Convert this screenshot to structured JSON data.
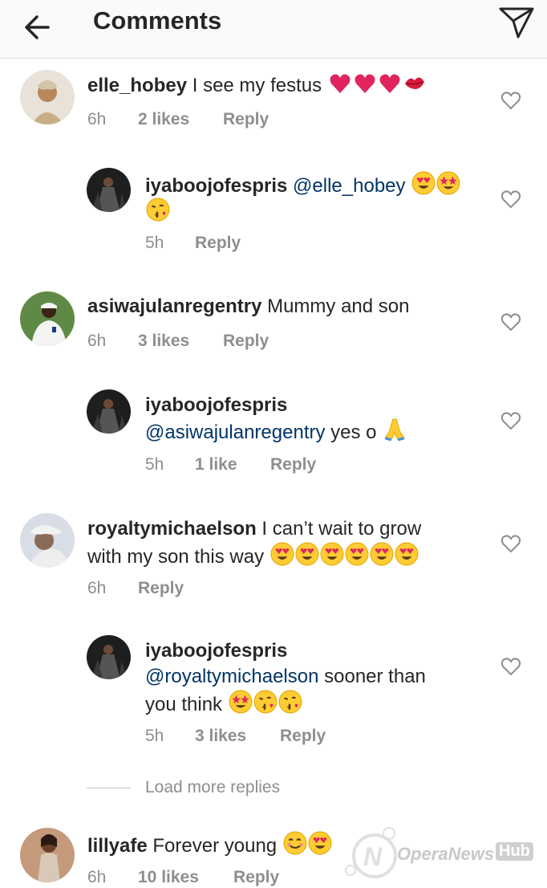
{
  "header": {
    "title": "Comments"
  },
  "comments": [
    {
      "username": "elle_hobey",
      "text": " I see my festus ",
      "time": "6h",
      "likes": "2 likes",
      "reply": "Reply"
    },
    {
      "username": "iyaboojofespris",
      "mention": "@elle_hobey",
      "time": "5h",
      "reply": "Reply"
    },
    {
      "username": "asiwajulanregentry",
      "text": " Mummy and son",
      "time": "6h",
      "likes": "3 likes",
      "reply": "Reply"
    },
    {
      "username": "iyaboojofespris",
      "mention": "@asiwajulanregentry",
      "text": " yes o ",
      "time": "5h",
      "likes": "1 like",
      "reply": "Reply"
    },
    {
      "username": "royaltymichaelson",
      "text": " I can’t wait to grow",
      "text2": "with my son this way ",
      "time": "6h",
      "reply": "Reply"
    },
    {
      "username": "iyaboojofespris",
      "mention": "@royaltymichaelson",
      "text": " sooner than",
      "text2": "you think ",
      "time": "5h",
      "likes": "3 likes",
      "reply": "Reply"
    },
    {
      "username": "lillyafe",
      "text": " Forever young ",
      "time": "6h",
      "likes": "10 likes",
      "reply": "Reply"
    }
  ],
  "load_more": "Load more replies",
  "watermark": {
    "brand": "OperaNews",
    "hub": "Hub"
  },
  "colors": {
    "mention": "#003569",
    "meta": "#8e8e8e",
    "heart": "#e0245e"
  }
}
